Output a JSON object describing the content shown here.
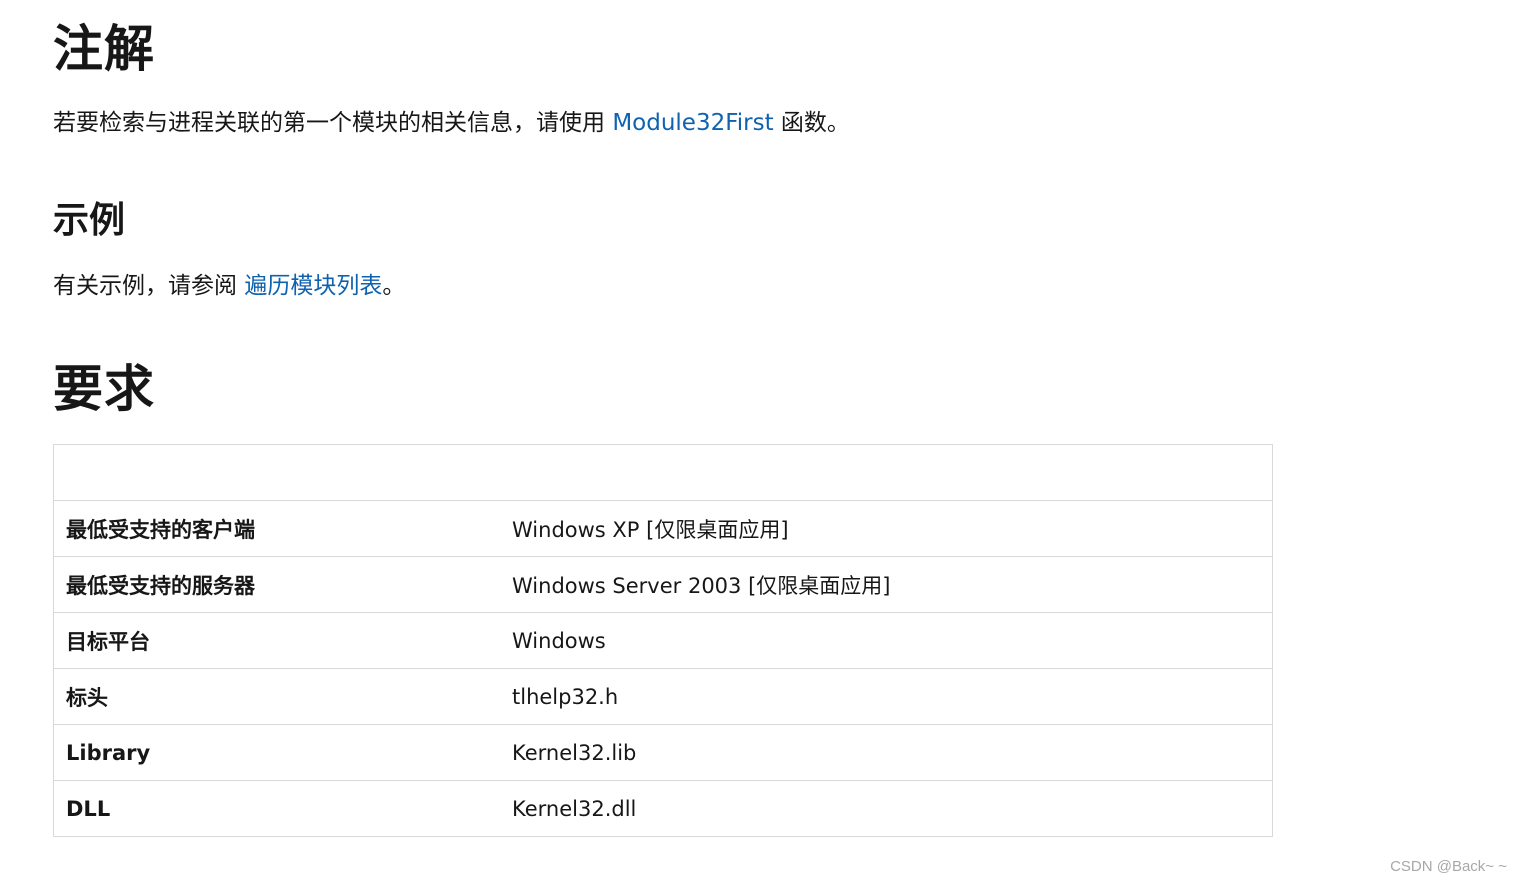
{
  "remarks": {
    "title": "注解",
    "text_before": "若要检索与进程关联的第一个模块的相关信息，请使用 ",
    "link": "Module32First",
    "text_after": " 函数。"
  },
  "example": {
    "title": "示例",
    "text_before": "有关示例，请参阅 ",
    "link": "遍历模块列表",
    "text_after": "。"
  },
  "requirements": {
    "title": "要求",
    "header": [
      "",
      ""
    ],
    "rows": [
      {
        "label": "最低受支持的客户端",
        "value": "Windows XP [仅限桌面应用]"
      },
      {
        "label": "最低受支持的服务器",
        "value": "Windows Server 2003 [仅限桌面应用]"
      },
      {
        "label": "目标平台",
        "value": "Windows"
      },
      {
        "label": "标头",
        "value": "tlhelp32.h"
      },
      {
        "label": "Library",
        "value": "Kernel32.lib"
      },
      {
        "label": "DLL",
        "value": "Kernel32.dll"
      }
    ]
  },
  "watermark": "CSDN @Back~ ~",
  "colors": {
    "link": "#0f62b0",
    "text": "#171717",
    "border": "#d9d9d9",
    "watermark": "#a8a8a8"
  }
}
